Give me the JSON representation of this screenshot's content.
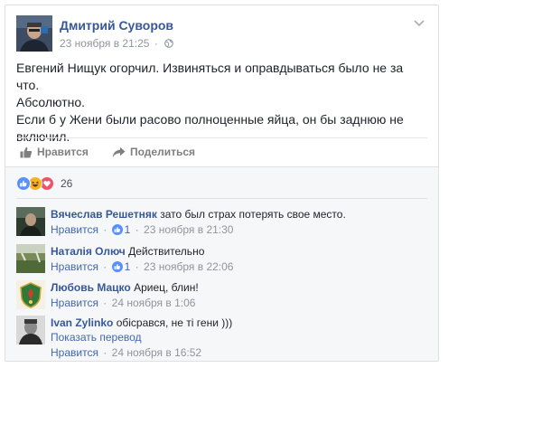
{
  "post": {
    "author": "Дмитрий Суворов",
    "timestamp": "23 ноября в 21:25",
    "separator": "·",
    "privacy_icon": "globe-icon",
    "lines": [
      "Евгений Нищук огорчил. Извиняться и оправдываться было не за что.",
      "Абсолютно.",
      "Если б у Жени были расово полноценные яйца, он бы заднюю не",
      "включил."
    ]
  },
  "actions": {
    "like_label": "Нравится",
    "share_label": "Поделиться"
  },
  "reactions": {
    "types": [
      "like",
      "haha",
      "love"
    ],
    "count": "26",
    "colors": {
      "like": "#5890ff",
      "haha": "#f7b125",
      "love": "#f25268"
    }
  },
  "comments": [
    {
      "author": "Вячеслав Решетняк",
      "text": "зато был страх потерять свое место.",
      "like_label": "Нравится",
      "like_count": "1",
      "time": "23 ноября в 21:30"
    },
    {
      "author": "Наталія Олюч",
      "text": "Действительно",
      "like_label": "Нравится",
      "like_count": "1",
      "time": "23 ноября в 22:06"
    },
    {
      "author": "Любовь Мацко",
      "text": "Ариец, блин!",
      "like_label": "Нравится",
      "time": "24 ноября в 1:06"
    },
    {
      "author": "Ivan Zylinko",
      "text": "обісрався, не ті гени )))",
      "translate_label": "Показать перевод",
      "like_label": "Нравится",
      "time": "24 ноября в 16:52"
    }
  ],
  "footer_separator": "·"
}
